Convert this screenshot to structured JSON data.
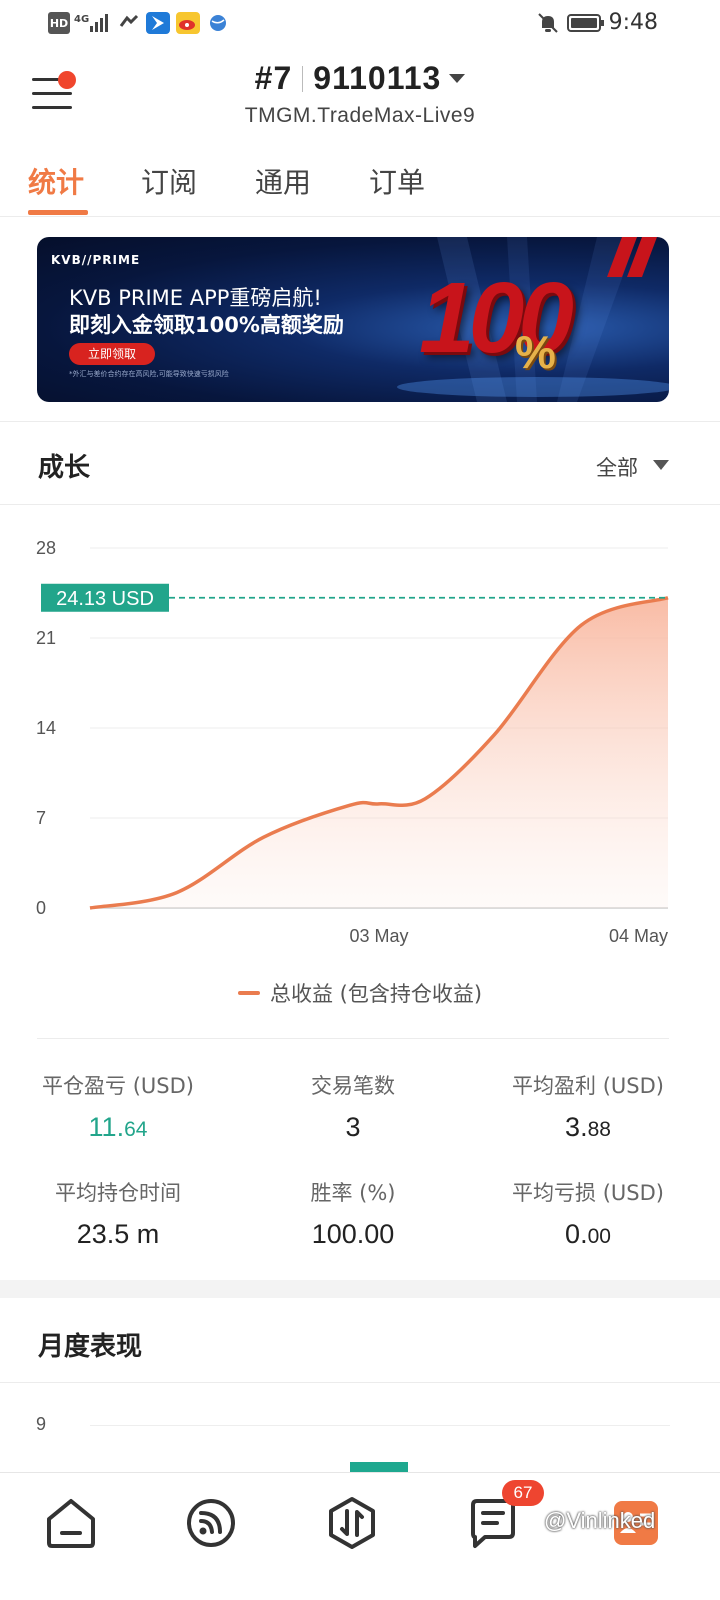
{
  "status_bar": {
    "left_icons": [
      "hd-icon",
      "signal-4g-icon",
      "wifi-call-icon",
      "app-icon-blue",
      "weibo-icon",
      "globe-icon"
    ],
    "hd_label": "HD",
    "net_label": "4G",
    "time": "9:48",
    "right_icons": [
      "mute-bell-icon",
      "battery-icon"
    ]
  },
  "header": {
    "account_prefix": "#7",
    "account_number": "9110113",
    "server": "TMGM.TradeMax-Live9",
    "menu_has_notification": true
  },
  "tabs": [
    {
      "label": "统计",
      "active": true
    },
    {
      "label": "订阅",
      "active": false
    },
    {
      "label": "通用",
      "active": false
    },
    {
      "label": "订单",
      "active": false
    }
  ],
  "banner": {
    "brand": "KVB//PRIME",
    "line1": "KVB PRIME APP重磅启航!",
    "line2": "即刻入金领取100%高额奖励",
    "cta": "立即领取",
    "disclaimer": "*外汇与差价合约存在高风险,可能导致快速亏损风险",
    "big_number": "100",
    "percent": "%"
  },
  "growth": {
    "title": "成长",
    "range": "全部",
    "current_label": "24.13 USD",
    "legend": "总收益 (包含持仓收益)"
  },
  "chart_data": {
    "type": "area",
    "y_ticks": [
      "0",
      "7",
      "14",
      "21",
      "28"
    ],
    "ylim": [
      0,
      28
    ],
    "x_ticks": [
      "03 May",
      "04 May"
    ],
    "x": [
      0,
      0.15,
      0.3,
      0.45,
      0.5,
      0.58,
      0.7,
      0.85,
      1.0
    ],
    "values": [
      0,
      1.2,
      5.5,
      8.0,
      8.1,
      8.5,
      13.5,
      22.0,
      24.13
    ],
    "reference_value": 24.13,
    "series": [
      {
        "name": "总收益 (包含持仓收益)",
        "color": "#ea7c4f"
      }
    ],
    "grid": true,
    "legend_position": "bottom"
  },
  "stats": [
    {
      "label": "平仓盈亏 (USD)",
      "value_main": "11.",
      "value_small": "64",
      "color": "#22a58b"
    },
    {
      "label": "交易笔数",
      "value_main": "3",
      "value_small": ""
    },
    {
      "label": "平均盈利 (USD)",
      "value_main": "3.",
      "value_small": "88"
    },
    {
      "label": "平均持仓时间",
      "value_main": "23.5 m",
      "value_small": ""
    },
    {
      "label": "胜率 (%)",
      "value_main": "100.00",
      "value_small": ""
    },
    {
      "label": "平均亏损 (USD)",
      "value_main": "0.",
      "value_small": "00"
    }
  ],
  "monthly": {
    "title": "月度表现",
    "y_top": "9"
  },
  "bottom_nav": {
    "items": [
      "home-icon",
      "signal-icon",
      "trade-icon",
      "messages-icon",
      "profile-icon"
    ],
    "badge": "67"
  },
  "watermark": "@Vinlinked"
}
